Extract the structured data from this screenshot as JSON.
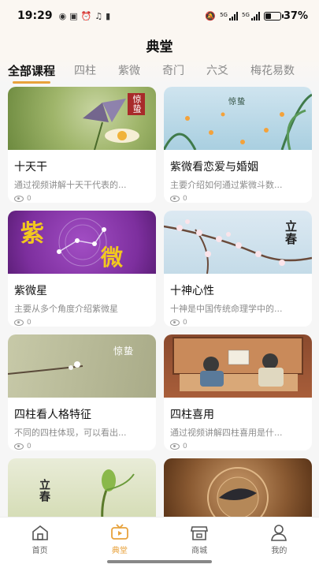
{
  "status": {
    "time": "19:29",
    "battery": "37%",
    "battery_level": 0.37,
    "signal1": "5G",
    "signal2": "5G"
  },
  "header": {
    "title": "典堂"
  },
  "tabs": [
    "全部课程",
    "四柱",
    "紫微",
    "奇门",
    "六爻",
    "梅花易数"
  ],
  "images": {
    "c1": "惊蛰",
    "c2": "惊蛰",
    "c3a": "紫",
    "c3b": "微",
    "c4": "立春",
    "c5": "惊蛰",
    "c7": "立春"
  },
  "courses": [
    {
      "title": "十天干",
      "desc": "通过视频讲解十天干代表的...",
      "views": "0"
    },
    {
      "title": "紫微看恋爱与婚姻",
      "desc": "主要介绍如何通过紫微斗数...",
      "views": "0"
    },
    {
      "title": "紫微星",
      "desc": "主要从多个角度介绍紫微星",
      "views": "0"
    },
    {
      "title": "十神心性",
      "desc": "十神是中国传统命理学中的...",
      "views": "0"
    },
    {
      "title": "四柱看人格特征",
      "desc": "不同的四柱体现，可以看出...",
      "views": "0"
    },
    {
      "title": "四柱喜用",
      "desc": "通过视频讲解四柱喜用是什...",
      "views": "0"
    },
    {
      "title": "",
      "desc": "",
      "views": ""
    },
    {
      "title": "",
      "desc": "",
      "views": ""
    }
  ],
  "bottom_nav": {
    "home": "首页",
    "dian": "典堂",
    "shop": "商城",
    "mine": "我的"
  },
  "colors": {
    "accent": "#e8a23c",
    "purple": "#8e3fb0"
  }
}
